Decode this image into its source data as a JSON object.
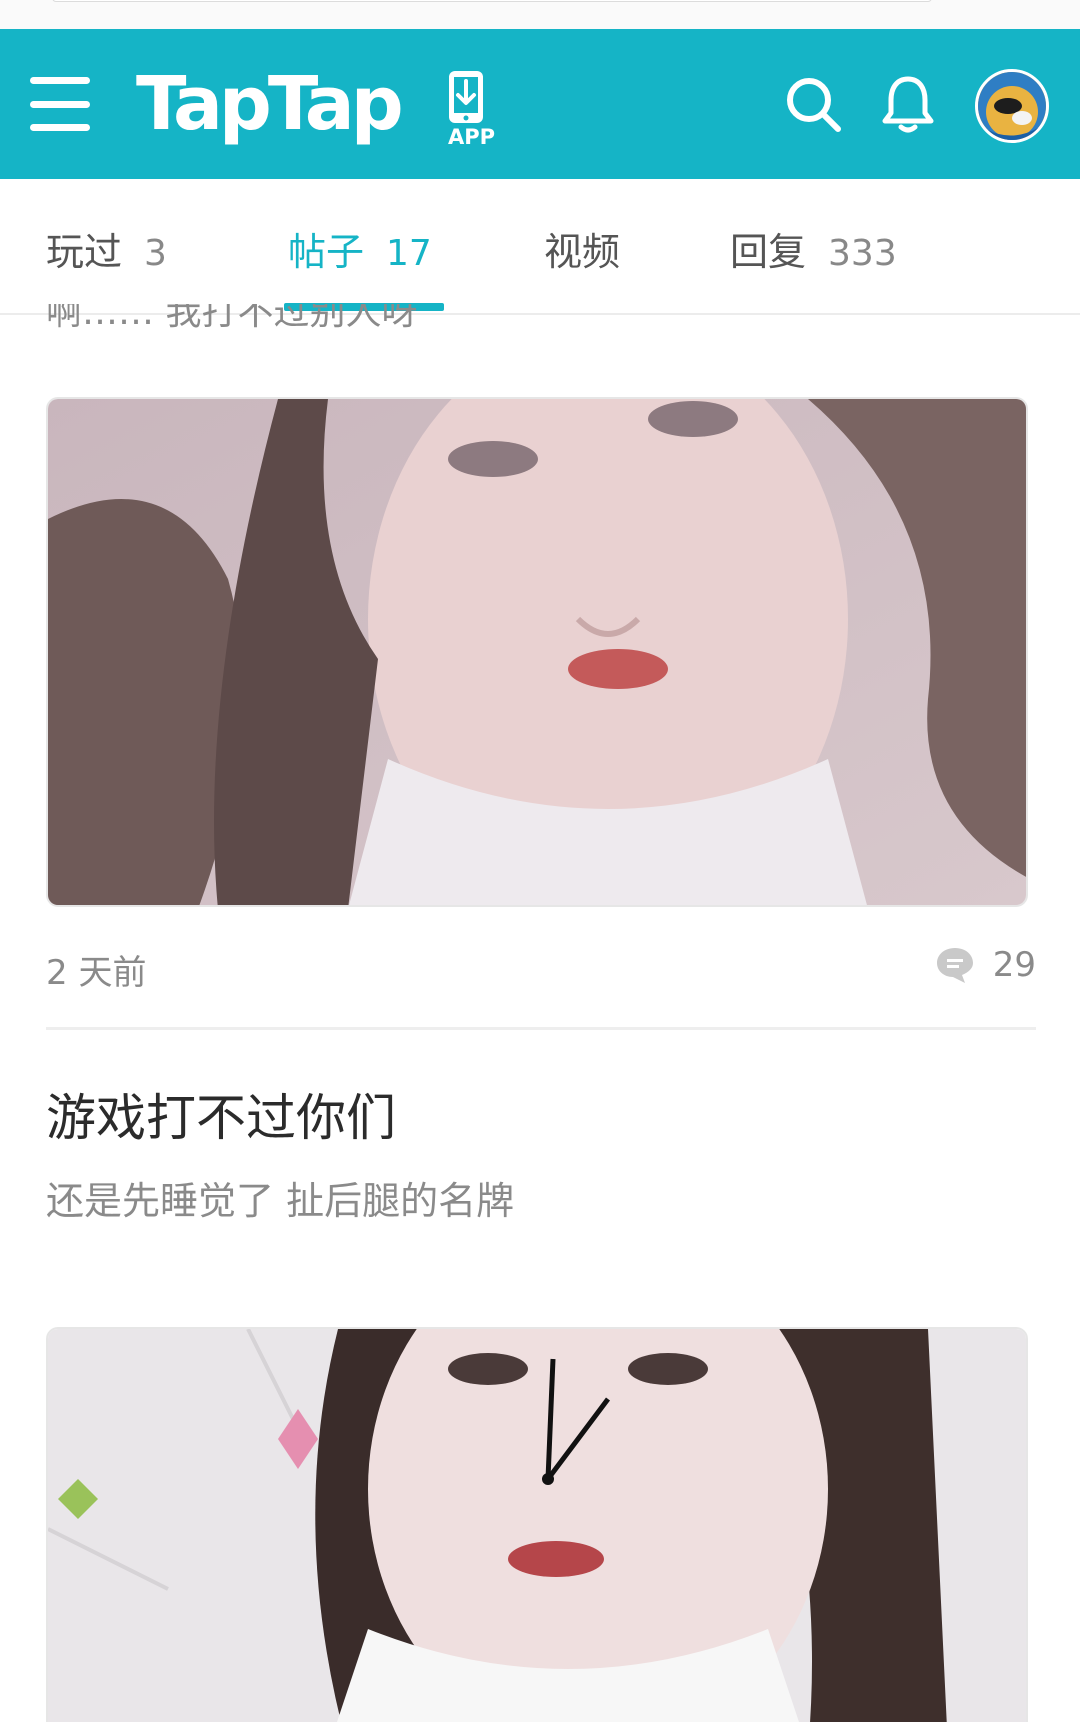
{
  "header": {
    "app_name": "TapTap",
    "download_label": "APP",
    "brand_color": "#15b4c6"
  },
  "tabs": [
    {
      "label": "玩过",
      "count": "3"
    },
    {
      "label": "帖子",
      "count": "17",
      "active": true
    },
    {
      "label": "视频",
      "count": ""
    },
    {
      "label": "回复",
      "count": "333"
    }
  ],
  "feed": {
    "previous_snippet": "啊…… 我打不过别人呀",
    "post1": {
      "time": "2 天前",
      "comment_count": "29"
    },
    "post2": {
      "title": "游戏打不过你们",
      "excerpt": "还是先睡觉了 扯后腿的名牌"
    }
  },
  "icons": [
    "menu-icon",
    "download-icon",
    "search-icon",
    "bell-icon",
    "comment-icon"
  ]
}
